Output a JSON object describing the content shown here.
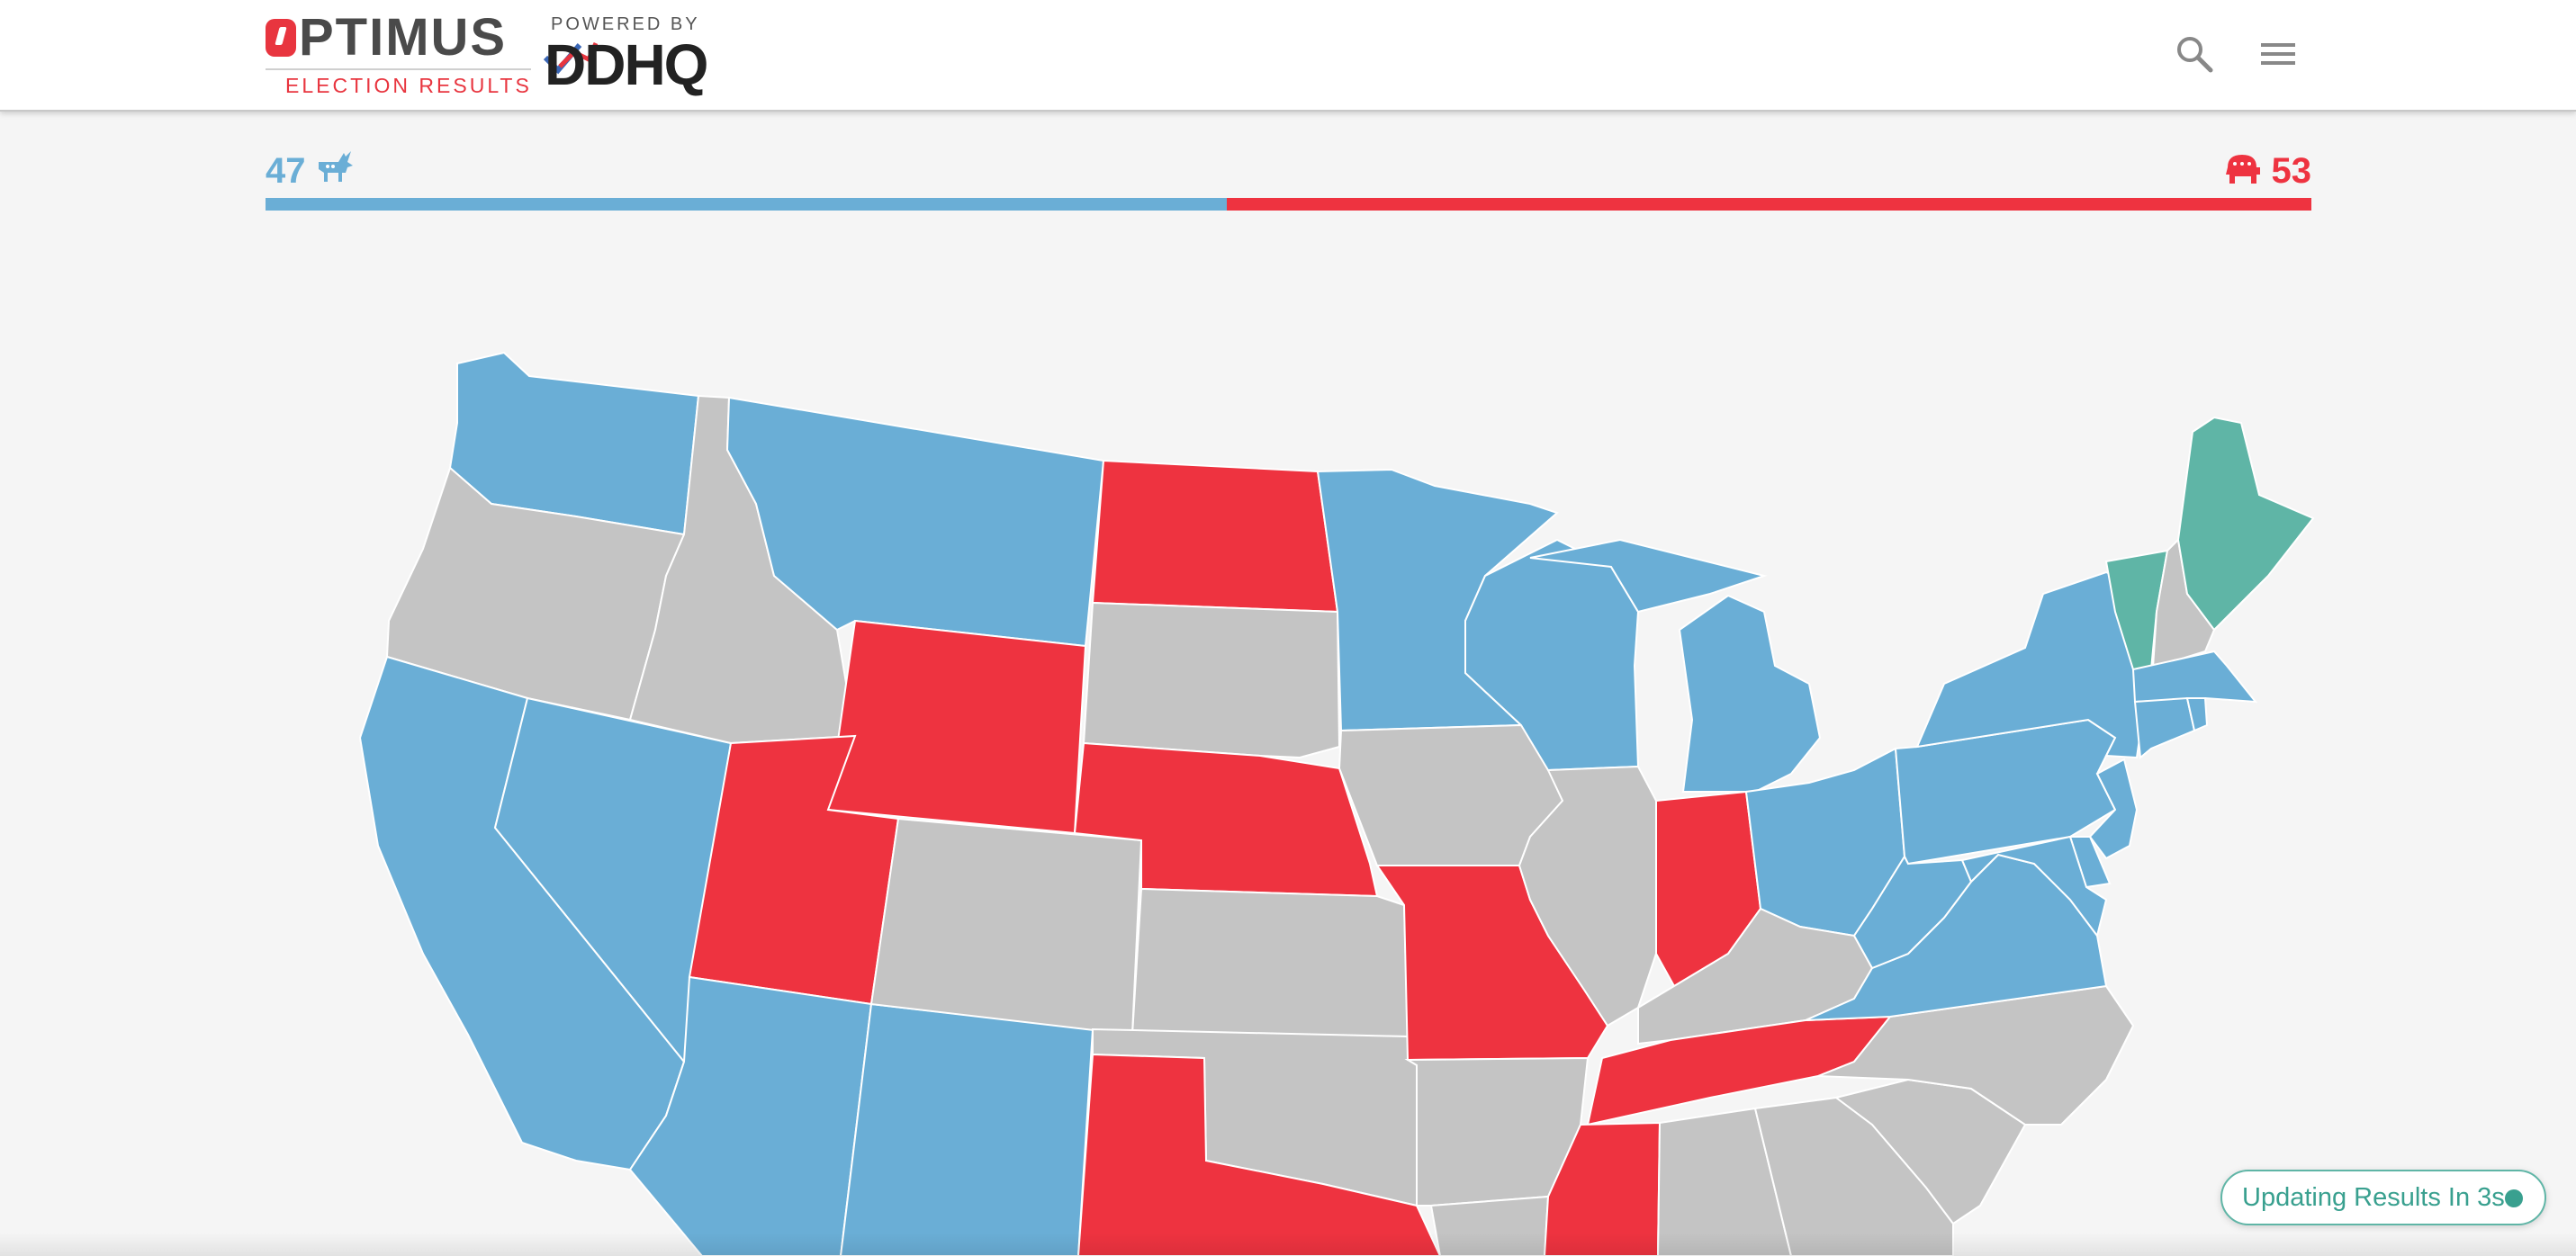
{
  "header": {
    "brand_name": "PTIMUS",
    "brand_sub": "ELECTION RESULTS",
    "powered_by": "POWERED BY",
    "partner": "DDHQ"
  },
  "tally": {
    "dem_seats": "47",
    "rep_seats": "53",
    "dem_fraction": 0.47,
    "rep_fraction": 0.53
  },
  "colors": {
    "dem": "#6aaed6",
    "rep": "#ee3340",
    "ind": "#5fb5a6",
    "undecided": "#c4c4c4"
  },
  "icons": {
    "search": "search-icon",
    "menu": "hamburger-menu-icon",
    "dem": "donkey-icon",
    "rep": "elephant-icon"
  },
  "states": {
    "WA": "dem",
    "OR": "undecided",
    "CA": "dem",
    "NV": "dem",
    "ID": "undecided",
    "MT": "dem",
    "WY": "rep",
    "UT": "rep",
    "AZ": "dem",
    "NM": "dem",
    "CO": "undecided",
    "ND": "rep",
    "SD": "undecided",
    "NE": "rep",
    "KS": "undecided",
    "OK": "undecided",
    "TX": "rep",
    "MN": "dem",
    "IA": "undecided",
    "MO": "rep",
    "AR": "undecided",
    "LA": "undecided",
    "WI": "dem",
    "IL": "undecided",
    "MI": "dem",
    "IN": "rep",
    "OH": "dem",
    "KY": "undecided",
    "TN": "rep",
    "MS": "rep",
    "AL": "undecided",
    "GA": "undecided",
    "SC": "undecided",
    "NC": "undecided",
    "VA": "dem",
    "WV": "dem",
    "PA": "dem",
    "NY": "dem",
    "VT": "ind",
    "NH": "undecided",
    "ME": "ind",
    "MA": "dem",
    "CT": "dem",
    "RI": "dem",
    "NJ": "dem",
    "DE": "dem",
    "MD": "dem"
  },
  "status": {
    "updating_text": "Updating Results In 3s"
  }
}
